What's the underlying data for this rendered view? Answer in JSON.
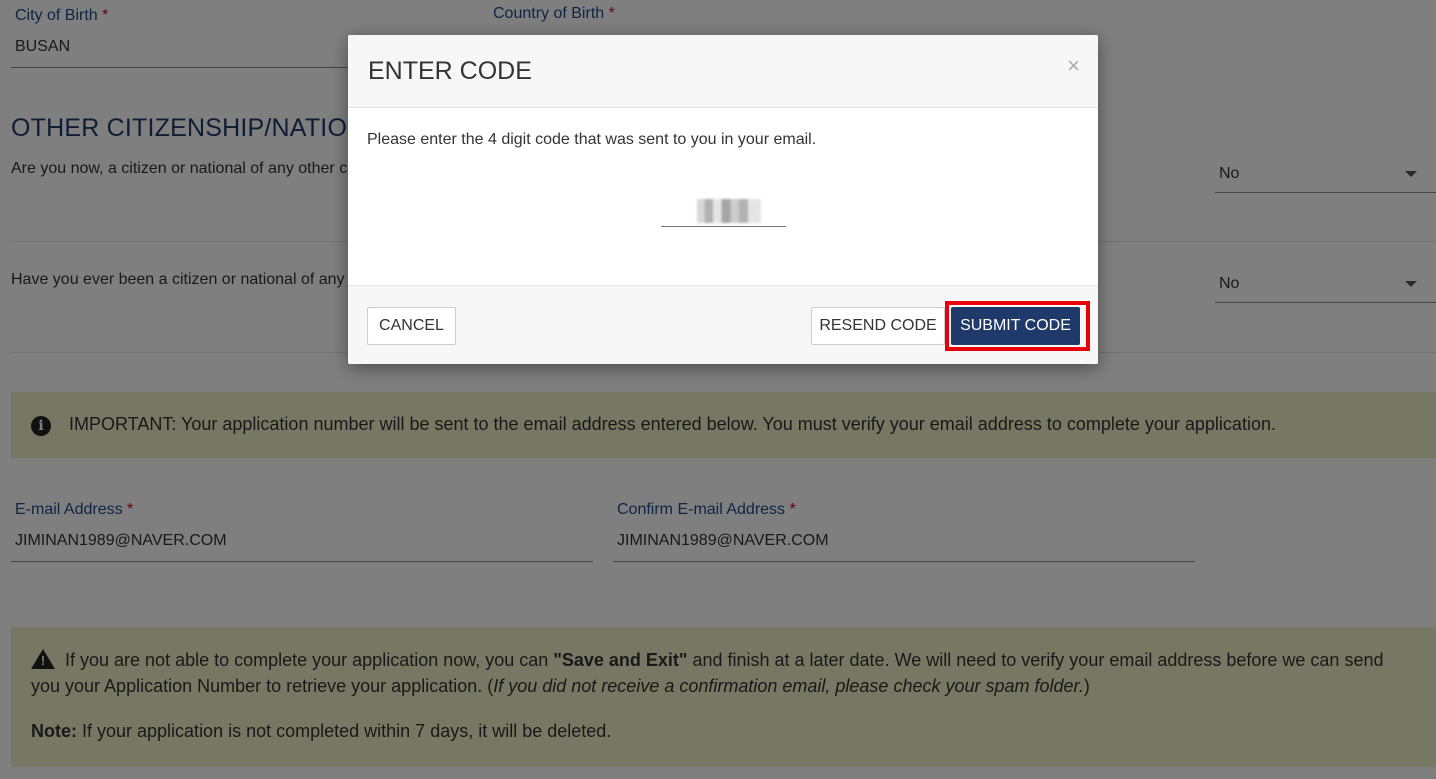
{
  "form": {
    "city_label": "City of Birth",
    "city_value": "BUSAN",
    "country_label": "Country of Birth",
    "required_mark": "*",
    "section_title": "OTHER CITIZENSHIP/NATIONALITY",
    "q1": "Are you now, a citizen or national of any other country?",
    "q1_answer": "No",
    "q2": "Have you ever been a citizen or national of any other country?",
    "q2_answer": "No",
    "important_notice": "IMPORTANT: Your application number will be sent to the email address entered below. You must verify your email address to complete your application.",
    "email_label": "E-mail Address",
    "email_value": "JIMINAN1989@NAVER.COM",
    "confirm_email_label": "Confirm E-mail Address",
    "confirm_email_value": "JIMINAN1989@NAVER.COM",
    "save_notice_pre": "If you are not able to complete your application now, you can ",
    "save_notice_bold": "\"Save and Exit\"",
    "save_notice_mid": " and finish at a later date. We will need to verify your email address before we can send you your Application Number to retrieve your application. (",
    "save_notice_italic": "If you did not receive a confirmation email, please check your spam folder.",
    "save_notice_end": ")",
    "note_label": "Note:",
    "note_text": " If your application is not completed within 7 days, it will be deleted."
  },
  "modal": {
    "title": "ENTER CODE",
    "close_symbol": "×",
    "message": "Please enter the 4 digit code that was sent to you in your email.",
    "cancel_label": "CANCEL",
    "resend_label": "RESEND CODE",
    "submit_label": "SUBMIT CODE"
  },
  "colors": {
    "label_blue": "#1f4a8a",
    "primary_navy": "#1f3a6a",
    "notice_bg": "#eef0c7",
    "highlight_red": "#e8000b",
    "required_red": "#d0021b"
  },
  "icons": {
    "info": "info-circle-icon",
    "warning": "warning-triangle-icon",
    "dropdown": "chevron-down-icon",
    "close": "close-icon"
  }
}
